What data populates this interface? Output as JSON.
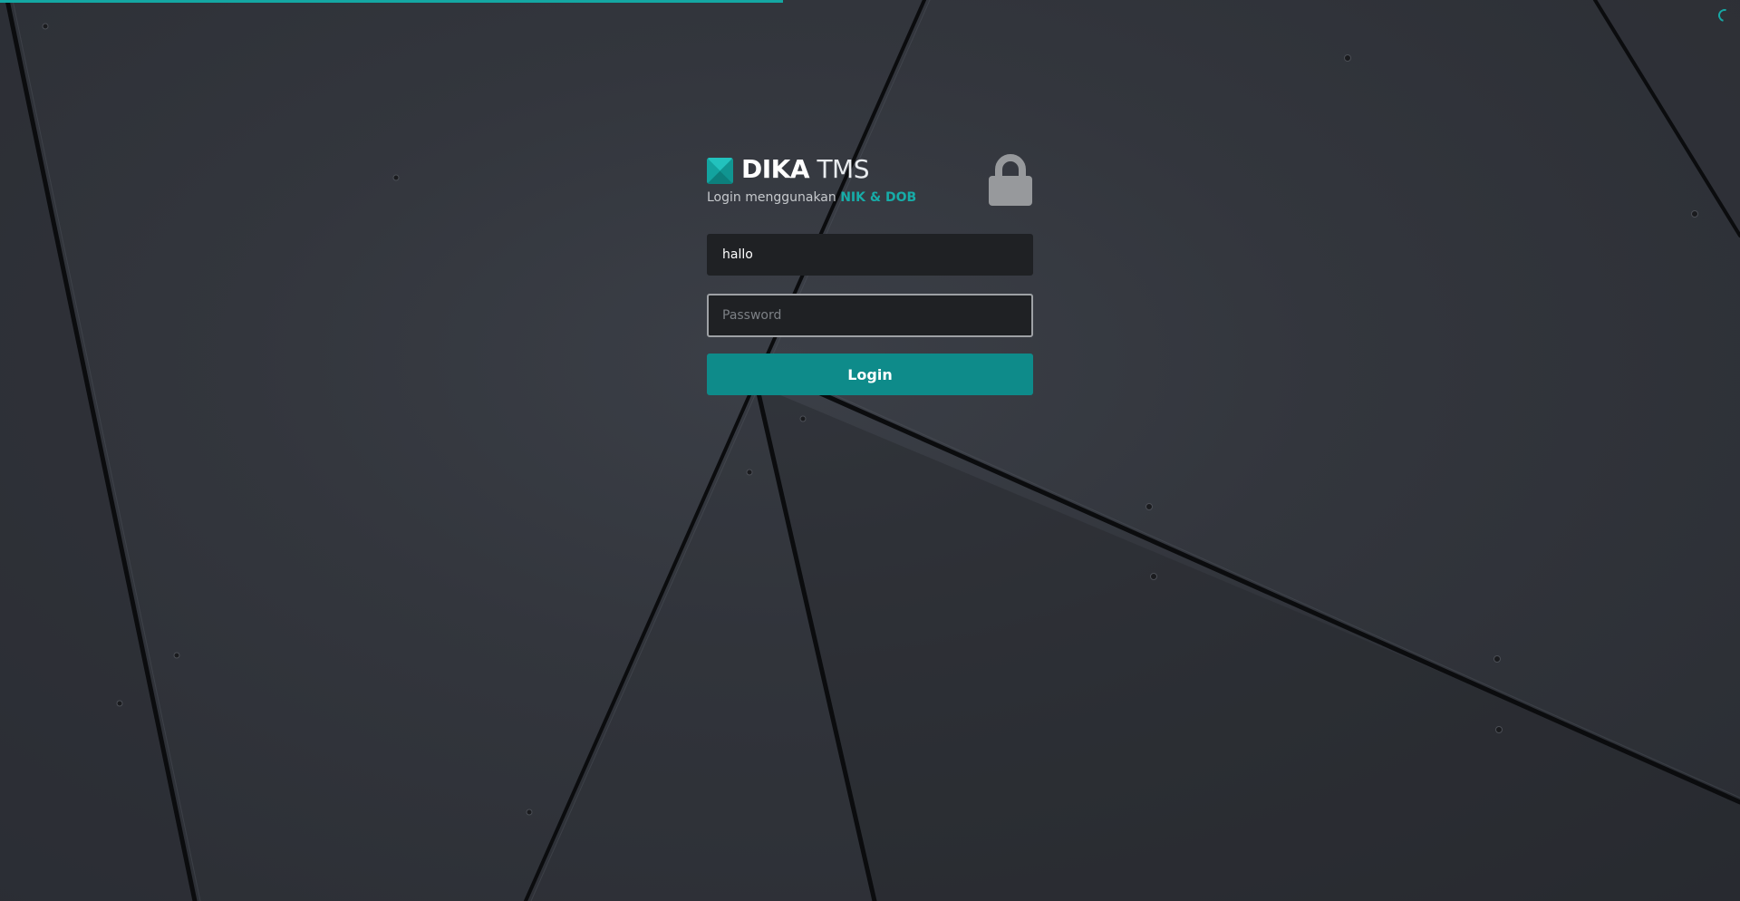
{
  "app": {
    "brand_strong": "DIKA",
    "brand_light": "TMS",
    "subtitle_prefix": "Login menggunakan",
    "subtitle_highlight": "NIK & DOB"
  },
  "form": {
    "username_value": "hallo",
    "password_placeholder": "Password",
    "login_label": "Login"
  },
  "page_load_progress": 0.45,
  "colors": {
    "accent": "#16a9a6",
    "button": "#0e8b8a",
    "background": "#33363d",
    "field_background": "#1f2124",
    "lock_icon": "#97999c"
  },
  "icons": {
    "logo": "brand-logo-icon",
    "lock": "lock-icon",
    "spinner": "loading-spinner-icon"
  }
}
